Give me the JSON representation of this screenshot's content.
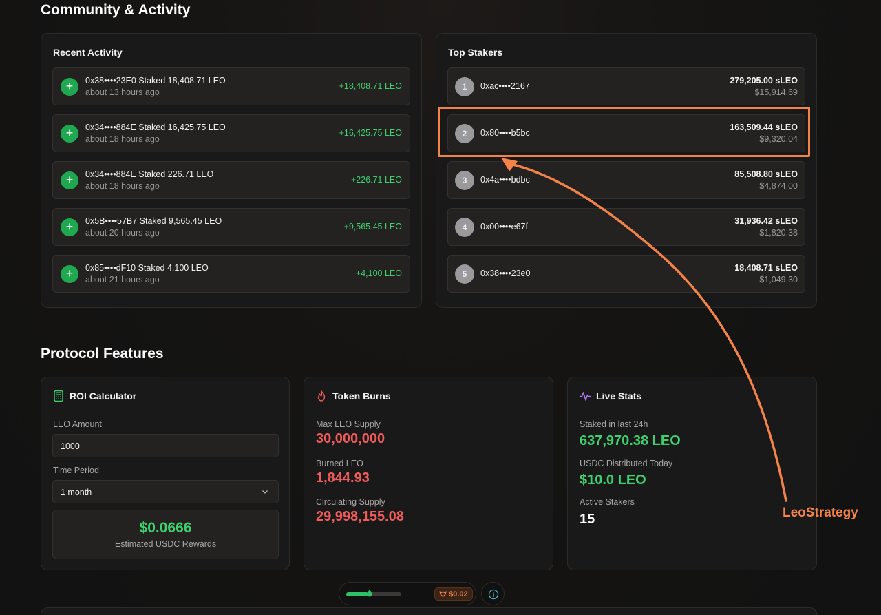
{
  "community": {
    "title": "Community & Activity",
    "recent_activity": {
      "title": "Recent Activity",
      "items": [
        {
          "text": "0x38••••23E0 Staked 18,408.71 LEO",
          "time": "about 13 hours ago",
          "amount": "+18,408.71 LEO"
        },
        {
          "text": "0x34••••884E Staked 16,425.75 LEO",
          "time": "about 18 hours ago",
          "amount": "+16,425.75 LEO"
        },
        {
          "text": "0x34••••884E Staked 226.71 LEO",
          "time": "about 18 hours ago",
          "amount": "+226.71 LEO"
        },
        {
          "text": "0x5B••••57B7 Staked 9,565.45 LEO",
          "time": "about 20 hours ago",
          "amount": "+9,565.45 LEO"
        },
        {
          "text": "0x85••••dF10 Staked 4,100 LEO",
          "time": "about 21 hours ago",
          "amount": "+4,100 LEO"
        }
      ]
    },
    "top_stakers": {
      "title": "Top Stakers",
      "items": [
        {
          "rank": "1",
          "address": "0xac••••2167",
          "amount": "279,205.00 sLEO",
          "usd": "$15,914.69"
        },
        {
          "rank": "2",
          "address": "0x80••••b5bc",
          "amount": "163,509.44 sLEO",
          "usd": "$9,320.04"
        },
        {
          "rank": "3",
          "address": "0x4a••••bdbc",
          "amount": "85,508.80 sLEO",
          "usd": "$4,874.00"
        },
        {
          "rank": "4",
          "address": "0x00••••e67f",
          "amount": "31,936.42 sLEO",
          "usd": "$1,820.38"
        },
        {
          "rank": "5",
          "address": "0x38••••23e0",
          "amount": "18,408.71 sLEO",
          "usd": "$1,049.30"
        }
      ]
    }
  },
  "features": {
    "title": "Protocol Features",
    "roi": {
      "title": "ROI Calculator",
      "icon": "calculator-icon",
      "amount_label": "LEO Amount",
      "amount_value": "1000",
      "period_label": "Time Period",
      "period_value": "1 month",
      "result_value": "$0.0666",
      "result_label": "Estimated USDC Rewards"
    },
    "burns": {
      "title": "Token Burns",
      "icon": "flame-icon",
      "max_label": "Max LEO Supply",
      "max_value": "30,000,000",
      "burned_label": "Burned LEO",
      "burned_value": "1,844.93",
      "circ_label": "Circulating Supply",
      "circ_value": "29,998,155.08"
    },
    "live": {
      "title": "Live Stats",
      "icon": "activity-icon",
      "staked_label": "Staked in last 24h",
      "staked_value": "637,970.38 LEO",
      "usdc_label": "USDC Distributed Today",
      "usdc_value": "$10.0 LEO",
      "stakers_label": "Active Stakers",
      "stakers_value": "15"
    }
  },
  "annotation": {
    "label": "LeoStrategy",
    "color": "#f4834a"
  },
  "bottom_bar": {
    "progress": 0.4,
    "price": "$0.02"
  },
  "colors": {
    "accent_green": "#3ecf6e",
    "accent_red": "#f05b5b",
    "annotation_orange": "#f4834a"
  }
}
